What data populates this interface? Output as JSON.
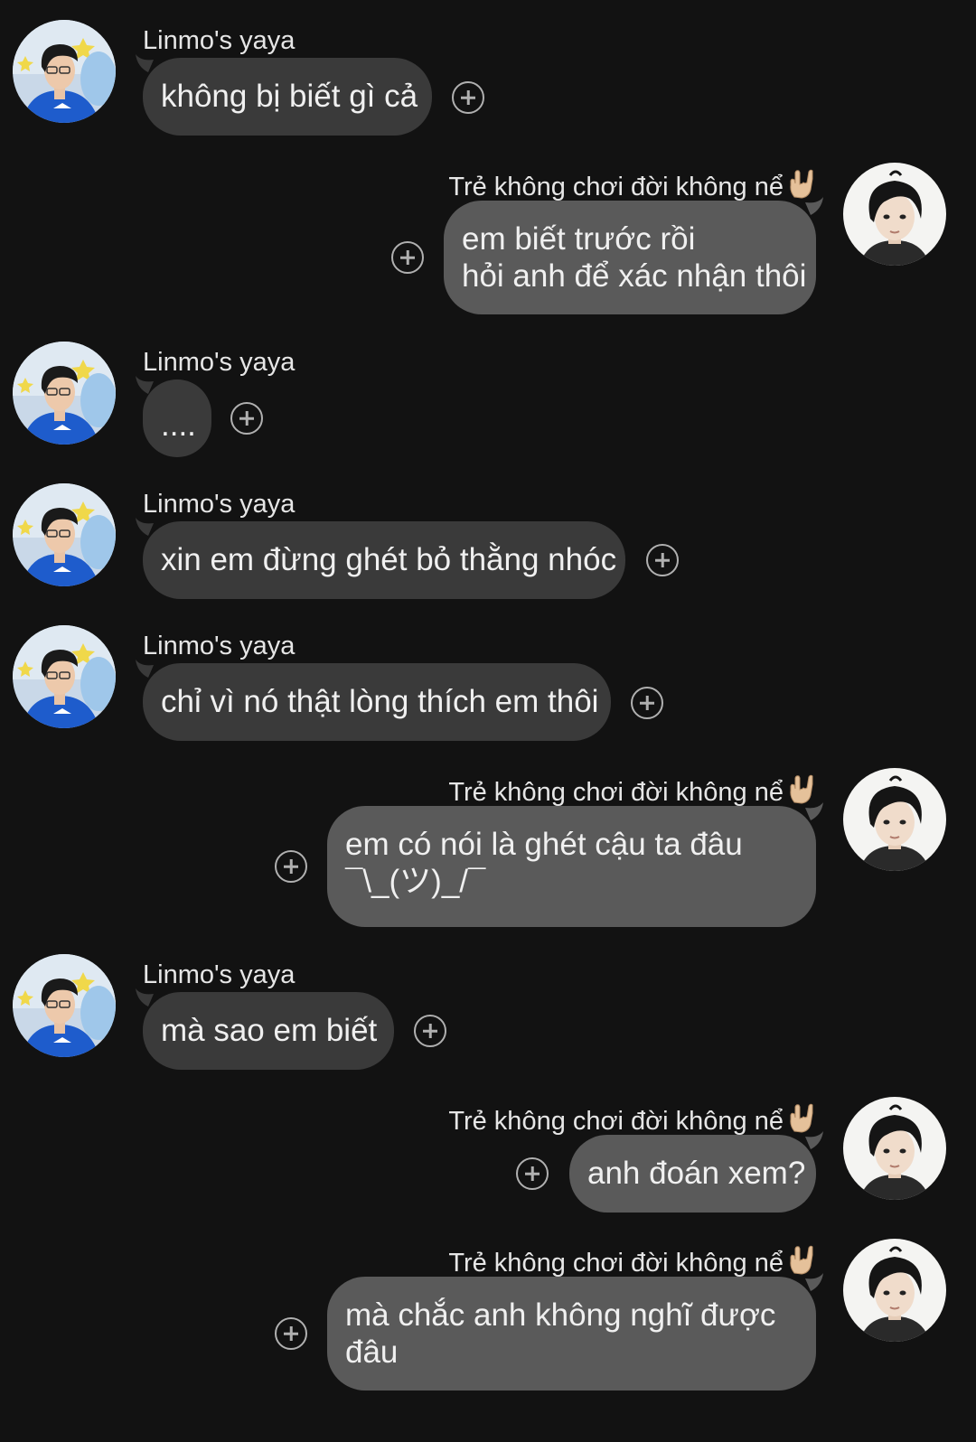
{
  "colors": {
    "background": "#121212",
    "incoming_bubble": "#3a3a3a",
    "outgoing_bubble": "#5a5a5a",
    "text": "#f0f0f0"
  },
  "contacts": {
    "other": {
      "name": "Linmo's yaya",
      "avatar_icon": "person-avatar-blue-jacket"
    },
    "self": {
      "name": "Trẻ không chơi đời không nể",
      "name_emoji": "hand-sign-emoji",
      "avatar_icon": "person-avatar-dark-hair"
    }
  },
  "add_reaction_icon": "plus-circle-icon",
  "messages": [
    {
      "from": "other",
      "lines": [
        "không bị biết gì cả"
      ]
    },
    {
      "from": "self",
      "lines": [
        "em biết trước rồi",
        "hỏi anh để xác nhận thôi"
      ]
    },
    {
      "from": "other",
      "lines": [
        "...."
      ]
    },
    {
      "from": "other",
      "lines": [
        "xin em đừng ghét bỏ thằng nhóc"
      ]
    },
    {
      "from": "other",
      "lines": [
        "chỉ vì nó thật lòng thích em thôi"
      ]
    },
    {
      "from": "self",
      "lines": [
        "em có nói là ghét cậu ta đâu",
        "¯\\_(ツ)_/¯"
      ]
    },
    {
      "from": "other",
      "lines": [
        "mà sao em biết"
      ]
    },
    {
      "from": "self",
      "lines": [
        "anh đoán xem?"
      ]
    },
    {
      "from": "self",
      "lines": [
        "mà chắc anh không nghĩ được",
        "đâu"
      ]
    }
  ]
}
